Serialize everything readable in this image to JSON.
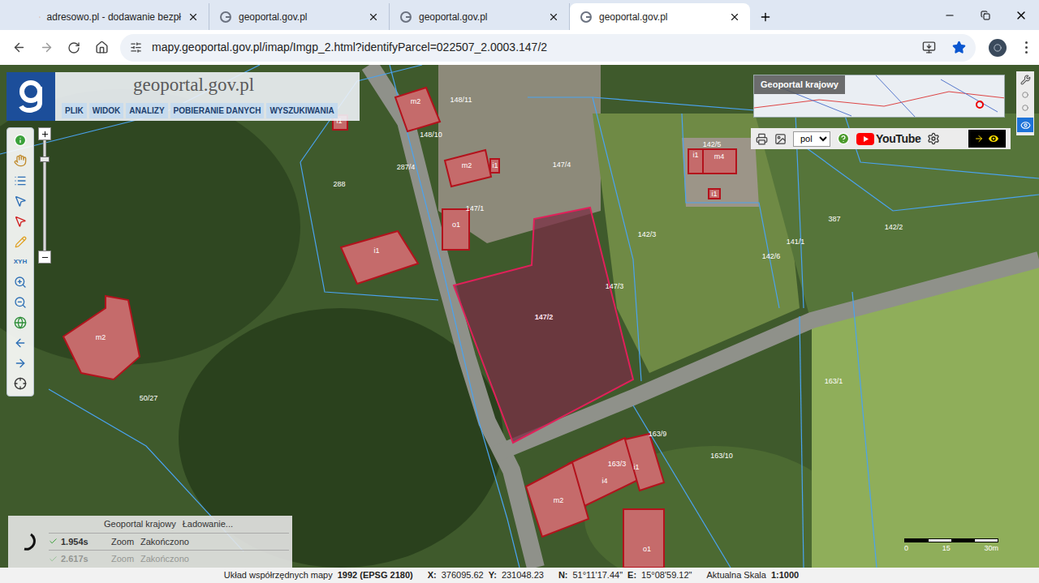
{
  "browser": {
    "tabs": [
      {
        "title": "adresowo.pl - dodawanie bezpł",
        "selected": false
      },
      {
        "title": "geoportal.gov.pl",
        "selected": false
      },
      {
        "title": "geoportal.gov.pl",
        "selected": false
      },
      {
        "title": "geoportal.gov.pl",
        "selected": true
      }
    ],
    "url": "mapy.geoportal.gov.pl/imap/Imgp_2.html?identifyParcel=022507_2.0003.147/2"
  },
  "app": {
    "title": "geoportal.gov.pl",
    "menu": [
      "PLIK",
      "WIDOK",
      "ANALIZY",
      "POBIERANIE DANYCH",
      "WYSZUKIWANIA"
    ]
  },
  "tools": {
    "coordinates_label": "XYH"
  },
  "zoom_slider": {
    "level": 0.85
  },
  "overview": {
    "title": "Geoportal krajowy"
  },
  "toolbar": {
    "language": "pol",
    "youtube": "YouTube"
  },
  "map": {
    "parcels": [
      {
        "label": "148/11",
        "selected": false
      },
      {
        "label": "148/10",
        "selected": false
      },
      {
        "label": "287/4",
        "selected": false
      },
      {
        "label": "288",
        "selected": false
      },
      {
        "label": "147/4",
        "selected": false
      },
      {
        "label": "147/1",
        "selected": false
      },
      {
        "label": "147/2",
        "selected": true
      },
      {
        "label": "147/3",
        "selected": false
      },
      {
        "label": "142/3",
        "selected": false
      },
      {
        "label": "142/5",
        "selected": false
      },
      {
        "label": "142/6",
        "selected": false
      },
      {
        "label": "387",
        "selected": false
      },
      {
        "label": "141/1",
        "selected": false
      },
      {
        "label": "142/2",
        "selected": false
      },
      {
        "label": "163/1",
        "selected": false
      },
      {
        "label": "163/9",
        "selected": false
      },
      {
        "label": "163/3",
        "selected": false
      },
      {
        "label": "163/10",
        "selected": false
      },
      {
        "label": "50/27",
        "selected": false
      }
    ],
    "buildings": [
      {
        "label": "m2"
      },
      {
        "label": "i1"
      },
      {
        "label": "m2"
      },
      {
        "label": "i1"
      },
      {
        "label": "o1"
      },
      {
        "label": "i1"
      },
      {
        "label": "m2"
      },
      {
        "label": "i1"
      },
      {
        "label": "m4"
      },
      {
        "label": "i1"
      },
      {
        "label": "i4"
      },
      {
        "label": "i1"
      },
      {
        "label": "m2"
      },
      {
        "label": "o1"
      }
    ]
  },
  "loading_panel": {
    "name": "Geoportal krajowy",
    "status": "Ładowanie...",
    "rows": [
      {
        "time": "1.954s",
        "action": "Zoom",
        "status": "Zakończono",
        "faded": false
      },
      {
        "time": "2.617s",
        "action": "Zoom",
        "status": "Zakończono",
        "faded": true
      }
    ]
  },
  "scale_bar": {
    "ticks": [
      "0",
      "15",
      "30m"
    ]
  },
  "status_bar": {
    "crs_label": "Układ współrzędnych mapy",
    "crs": "1992 (EPSG 2180)",
    "x_label": "X:",
    "x": "376095.62",
    "y_label": "Y:",
    "y": "231048.23",
    "n_label": "N:",
    "n": "51°11'17.44\"",
    "e_label": "E:",
    "e": "15°08'59.12\"",
    "scale_label": "Aktualna Skala",
    "scale": "1:1000"
  }
}
